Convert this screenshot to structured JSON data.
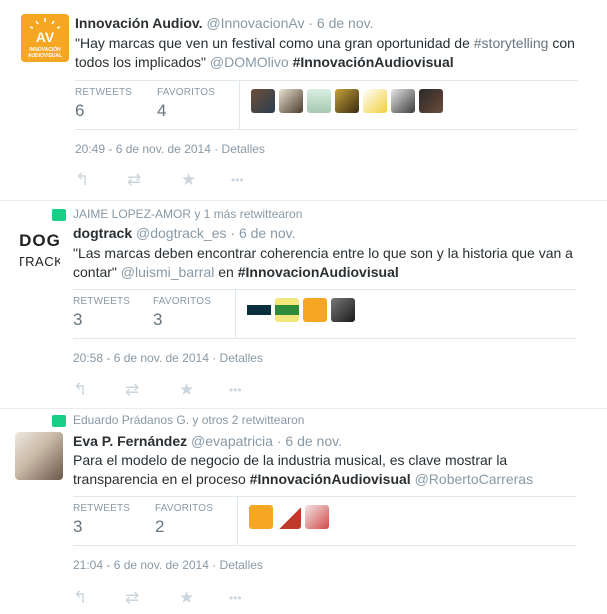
{
  "tweets": [
    {
      "author": {
        "name": "Innovación Audiov.",
        "handle": "@InnovacionAv",
        "date": "6 de nov.",
        "avatar_text": "INNOVACIÓN\nAUDIOVISUAL"
      },
      "text_parts": [
        "\"Hay marcas que ven un festival como una gran oportunidad de ",
        "#storytelling",
        " con todos los implicados\" ",
        "@DOMOlivo",
        " ",
        "#InnovaciónAudiovisual"
      ],
      "retweets_label": "RETWEETS",
      "retweets": "6",
      "favorites_label": "FAVORITOS",
      "favorites": "4",
      "datetime": "20:49 - 6 de nov. de 2014 · Detalles"
    },
    {
      "rt_by": "JAIME LOPEZ-AMOR y 1 más retwittearon",
      "author": {
        "name": "dogtrack",
        "handle": "@dogtrack_es",
        "date": "6 de nov.",
        "avatar_top": "DOG",
        "avatar_bottom": "TRACK"
      },
      "text_parts": [
        "\"Las marcas deben encontrar coherencia entre lo que son y la historia que van a contar\" ",
        "@luismi_barral",
        " en ",
        "#InnovacionAudiovisual"
      ],
      "retweets_label": "RETWEETS",
      "retweets": "3",
      "favorites_label": "FAVORITOS",
      "favorites": "3",
      "datetime": "20:58 - 6 de nov. de 2014 · Detalles"
    },
    {
      "rt_by": "Eduardo Prádanos G. y otros 2 retwittearon",
      "author": {
        "name": "Eva P. Fernández",
        "handle": "@evapatricia",
        "date": "6 de nov."
      },
      "text_parts": [
        "Para el modelo de negocio de la industria musical, es clave mostrar la transparencia en el proceso ",
        "#InnovaciónAudiovisual",
        " ",
        "@RobertoCarreras"
      ],
      "retweets_label": "RETWEETS",
      "retweets": "3",
      "favorites_label": "FAVORITOS",
      "favorites": "2",
      "datetime": "21:04 - 6 de nov. de 2014 · Detalles"
    }
  ],
  "actions": {
    "reply": "↰",
    "retweet": "⇄",
    "favorite": "★",
    "more": "•••"
  },
  "colors": {
    "brand_orange": "#f5a623",
    "retweet_green": "#19cf86",
    "grey": "#8899a6"
  }
}
